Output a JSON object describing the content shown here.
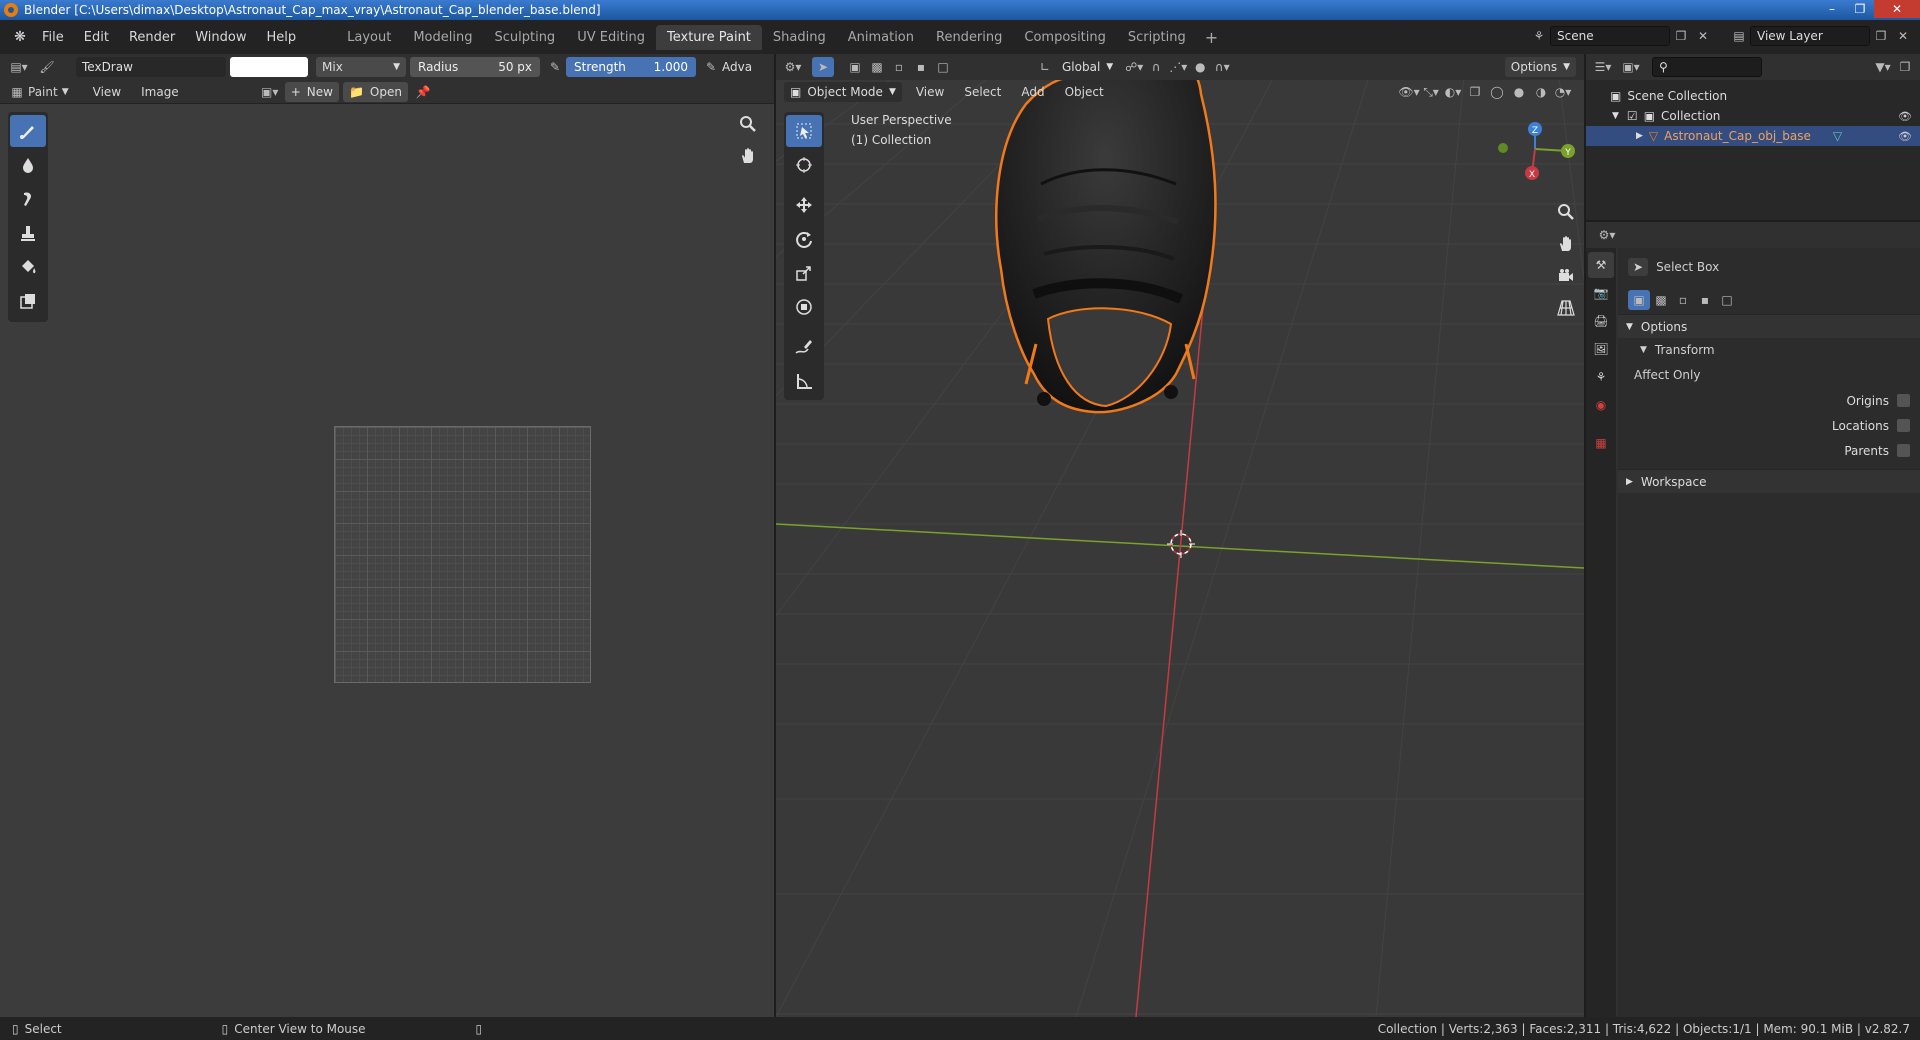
{
  "window": {
    "title": "Blender [C:\\Users\\dimax\\Desktop\\Astronaut_Cap_max_vray\\Astronaut_Cap_blender_base.blend]"
  },
  "menu": [
    "File",
    "Edit",
    "Render",
    "Window",
    "Help"
  ],
  "workspaces": [
    {
      "label": "Layout",
      "active": false
    },
    {
      "label": "Modeling",
      "active": false
    },
    {
      "label": "Sculpting",
      "active": false
    },
    {
      "label": "UV Editing",
      "active": false
    },
    {
      "label": "Texture Paint",
      "active": true
    },
    {
      "label": "Shading",
      "active": false
    },
    {
      "label": "Animation",
      "active": false
    },
    {
      "label": "Rendering",
      "active": false
    },
    {
      "label": "Compositing",
      "active": false
    },
    {
      "label": "Scripting",
      "active": false
    }
  ],
  "scene": {
    "value": "Scene"
  },
  "view_layer": {
    "value": "View Layer"
  },
  "image_editor": {
    "brush_name": "TexDraw",
    "blend_mode": "Mix",
    "radius_label": "Radius",
    "radius_value": "50 px",
    "strength_label": "Strength",
    "strength_value": "1.000",
    "adv_label": "Adva",
    "mode_label": "Paint",
    "view_label": "View",
    "image_label": "Image",
    "new_label": "New",
    "open_label": "Open"
  },
  "viewport": {
    "mode_label": "Object Mode",
    "menus": [
      "View",
      "Select",
      "Add",
      "Object"
    ],
    "transform_orientation": "Global",
    "options_label": "Options",
    "perspective_label": "User Perspective",
    "collection_label": "(1) Collection",
    "gizmo": {
      "x": "X",
      "y": "Y",
      "z": "Z"
    }
  },
  "outliner": {
    "scene_collection": "Scene Collection",
    "collection": "Collection",
    "object": "Astronaut_Cap_obj_base"
  },
  "properties": {
    "tool_name": "Select Box",
    "options_label": "Options",
    "transform_label": "Transform",
    "affect_only_label": "Affect Only",
    "origins_label": "Origins",
    "locations_label": "Locations",
    "parents_label": "Parents",
    "workspace_label": "Workspace"
  },
  "statusbar": {
    "select_label": "Select",
    "center_label": "Center View to Mouse",
    "stats": "Collection | Verts:2,363 | Faces:2,311 | Tris:4,622 | Objects:1/1 | Mem: 90.1 MiB | v2.82.7"
  },
  "colors": {
    "accent": "#4772b3",
    "selection_outline": "#f07a1a",
    "x_axis": "#c63a43",
    "y_axis": "#7aa12b",
    "z_axis": "#3d80d8"
  }
}
